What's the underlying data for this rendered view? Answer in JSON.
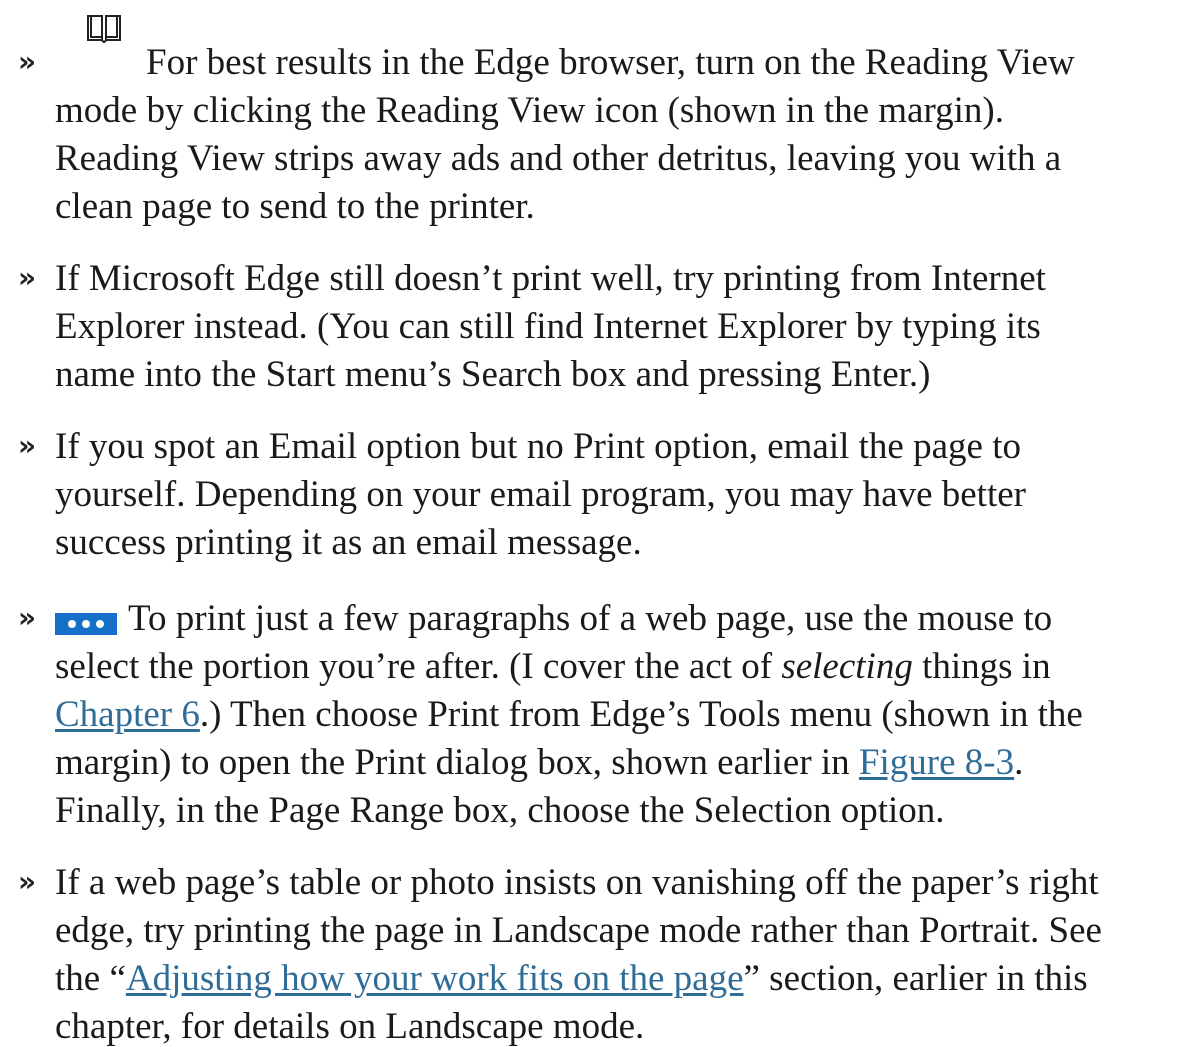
{
  "bullet_glyph": "»",
  "icons": {
    "reading_view": "book-icon",
    "tools_menu": "more-dots-icon",
    "tools_menu_color": "#1470c8"
  },
  "link_color": "#2f6d98",
  "items": [
    {
      "lines": [
        "For best results in the Edge browser, turn on the Reading View",
        "mode by clicking the Reading View icon (shown in the margin).",
        "Reading View strips away ads and other detritus, leaving you with a",
        "clean page to send to the printer."
      ]
    },
    {
      "lines": [
        "If Microsoft Edge still doesn’t print well, try printing from Internet",
        "Explorer instead. (You can still find Internet Explorer by typing its",
        "name into the Start menu’s Search box and pressing Enter.)"
      ]
    },
    {
      "lines": [
        "If you spot an Email option but no Print option, email the page to",
        "yourself. Depending on your email program, you may have better",
        "success printing it as an email message."
      ]
    },
    {
      "line1": "To print just a few paragraphs of a web page, use the mouse to",
      "line2_a": "select the portion you’re after. (I cover the act of ",
      "line2_em": "selecting",
      "line2_b": " things in",
      "line3_link": "Chapter 6",
      "line3_b": ".) Then choose Print from Edge’s Tools menu (shown in the",
      "line4_a": "margin) to open the Print dialog box, shown earlier in ",
      "line4_link": "Figure 8-3",
      "line4_b": ".",
      "line5": "Finally, in the Page Range box, choose the Selection option."
    },
    {
      "line1": "If a web page’s table or photo insists on vanishing off the paper’s right",
      "line2": "edge, try printing the page in Landscape mode rather than Portrait. See",
      "line3_a": "the “",
      "line3_link": "Adjusting how your work fits on the page",
      "line3_b": "” section, earlier in this",
      "line4": "chapter, for details on Landscape mode."
    }
  ]
}
